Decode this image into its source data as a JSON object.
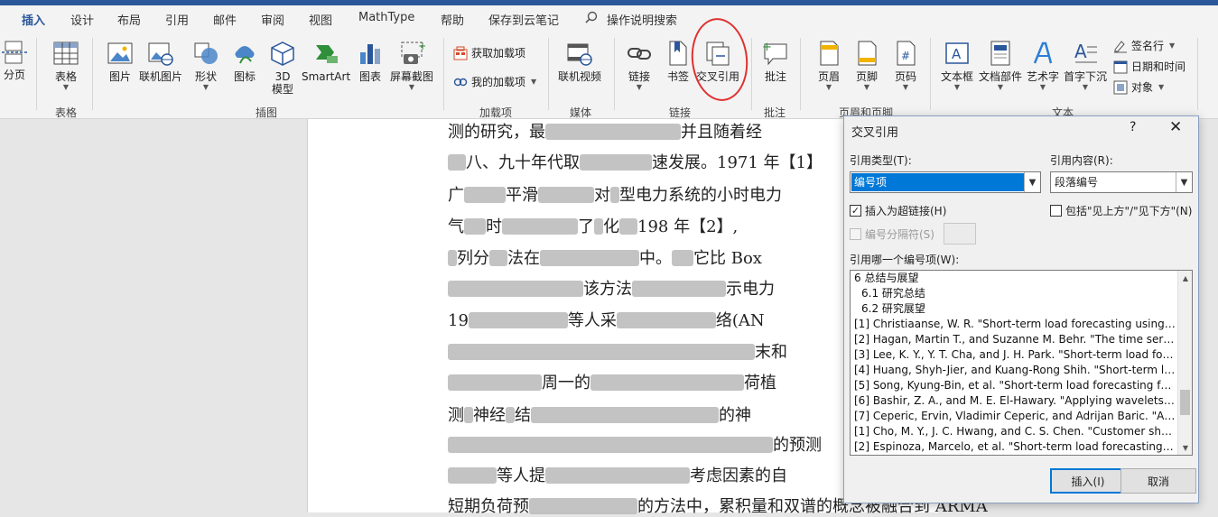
{
  "tabs": [
    "插入",
    "设计",
    "布局",
    "引用",
    "邮件",
    "审阅",
    "视图",
    "MathType",
    "帮助",
    "保存到云笔记",
    "操作说明搜索"
  ],
  "active_tab": "插入",
  "ribbon": {
    "page_break": "分页",
    "table": "表格",
    "picture": "图片",
    "online_picture": "联机图片",
    "shapes": "形状",
    "icons": "图标",
    "model_3d_1": "3D",
    "model_3d_2": "模型",
    "smartart": "SmartArt",
    "chart": "图表",
    "screenshot": "屏幕截图",
    "get_addins": "获取加载项",
    "my_addins": "我的加载项",
    "online_video": "联机视频",
    "link": "链接",
    "bookmark": "书签",
    "cross_reference": "交叉引用",
    "comment": "批注",
    "header": "页眉",
    "footer": "页脚",
    "page_number": "页码",
    "text_box": "文本框",
    "quick_parts": "文档部件",
    "wordart": "艺术字",
    "drop_cap": "首字下沉",
    "signature_line": "签名行",
    "date_time": "日期和时间",
    "object": "对象"
  },
  "groups": {
    "tables": "表格",
    "illustrations": "插图",
    "addins": "加载项",
    "media": "媒体",
    "links": "链接",
    "comments": "批注",
    "header_footer": "页眉和页脚",
    "text": "文本"
  },
  "document": {
    "line1": "测的研究，最",
    "line1b": "并且随着经",
    "line2": "八、九十年代取",
    "line2b": "速发展。1971 年【1】",
    "line3": "广",
    "line3b": "平滑",
    "line3c": "对",
    "line3d": "型电",
    "line3e": "力系统的小时电力",
    "line4": "气",
    "line4b": "时",
    "line4c": "了",
    "line4d": "化",
    "line4e": "198",
    "line4f": "年【2】,",
    "line5": "列分",
    "line5b": "法在",
    "line5c": "中。",
    "line5d": "它比 Box",
    "line6": "该方法",
    "line6b": "示电力",
    "line7": "19",
    "line7b": "等人采",
    "line7c": "络(AN",
    "line8": "末和",
    "line9": "周一的",
    "line9b": "荷植",
    "line10": "测",
    "line10b": "神经",
    "line10c": "结",
    "line10d": "的神",
    "line11": "的预测",
    "line12": "等人提",
    "line12b": "考虑因素的自",
    "line13": "短期负荷预",
    "line13b": "的方法中，累积量和双谱的概念被融合到 ARMA"
  },
  "dialog": {
    "title": "交叉引用",
    "help": "?",
    "close": "✕",
    "ref_type_label": "引用类型(T):",
    "ref_type_value": "编号项",
    "ref_content_label": "引用内容(R):",
    "ref_content_value": "段落编号",
    "insert_hyperlink": "插入为超链接(H)",
    "include_above_below": "包括\"见上方\"/\"见下方\"(N)",
    "separate_numbers": "编号分隔符(S)",
    "which_item_label": "引用哪一个编号项(W):",
    "items": [
      "6 总结与展望",
      "6.1 研究总结",
      "6.2 研究展望",
      "[1] Christiaanse, W. R. \"Short-term load forecasting using g...",
      "[2] Hagan, Martin T., and Suzanne M. Behr. \"The time series...",
      "[3] Lee, K. Y., Y. T. Cha, and J. H. Park. \"Short-term load fore...",
      "[4] Huang, Shyh-Jier, and Kuang-Rong Shih. \"Short-term loa...",
      "[5] Song, Kyung-Bin, et al. \"Short-term load forecasting for t...",
      "[6] Bashir, Z. A., and M. E. El-Hawary. \"Applying wavelets to ...",
      "[7] Ceperic, Ervin, Vladimir Ceperic, and Adrijan Baric. \"A str...",
      "[1] Cho, M. Y., J. C. Hwang, and C. S. Chen. \"Customer short ...",
      "[2] Espinoza, Marcelo, et al. \"Short-term load forecasting, p..."
    ],
    "insert_button": "插入(I)",
    "cancel_button": "取消"
  }
}
